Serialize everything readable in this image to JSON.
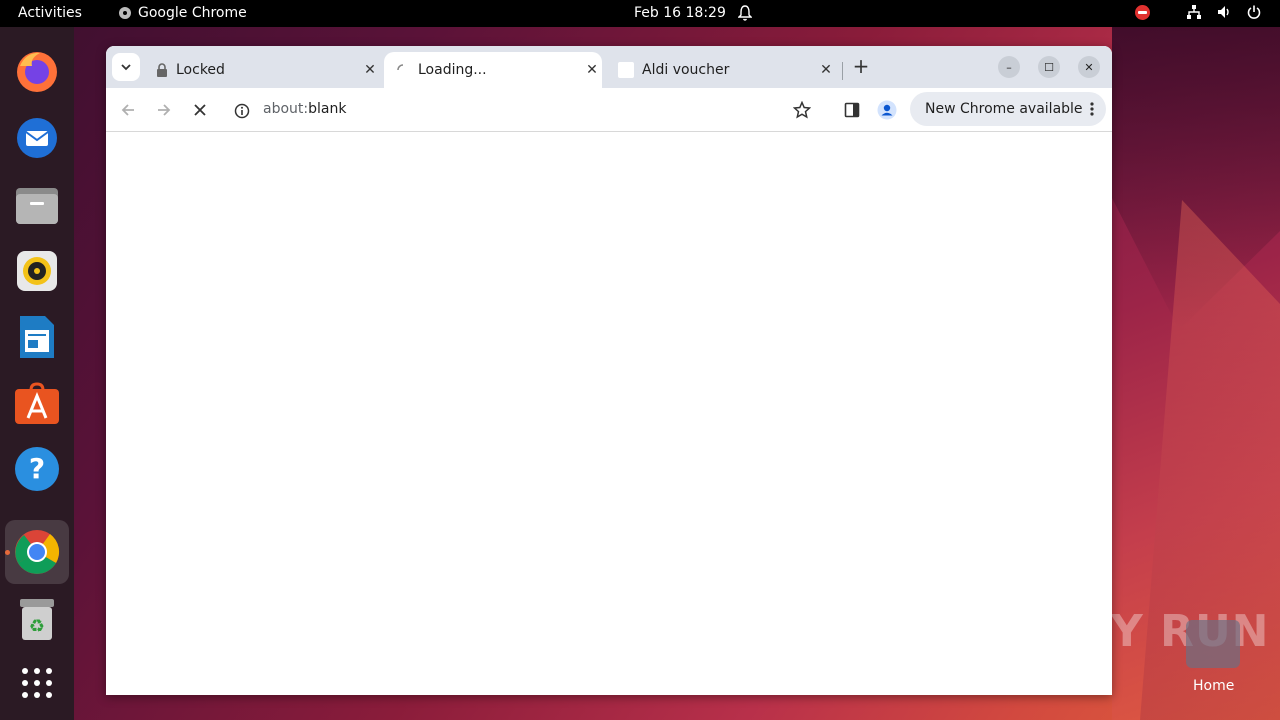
{
  "topbar": {
    "activities": "Activities",
    "app_name": "Google Chrome",
    "clock": "Feb 16  18:29"
  },
  "dock": {
    "items": [
      "firefox",
      "thunderbird",
      "files",
      "rhythmbox",
      "libreoffice-writer",
      "app-center",
      "help",
      "google-chrome",
      "trash",
      "show-apps"
    ]
  },
  "browser": {
    "tabs": [
      {
        "label": "Locked",
        "active": false
      },
      {
        "label": "Loading...",
        "active": true
      },
      {
        "label": "Aldi voucher",
        "active": false
      }
    ],
    "address": {
      "scheme": "about:",
      "host": "blank"
    },
    "update_button": "New Chrome available"
  },
  "desktop": {
    "watermark": "ANY RUN",
    "home_label": "Home"
  },
  "colors": {
    "topbar": "#000000",
    "dock": "#2b1a24",
    "tabstrip": "#dfe3eb",
    "accent": "#e66a3b"
  }
}
